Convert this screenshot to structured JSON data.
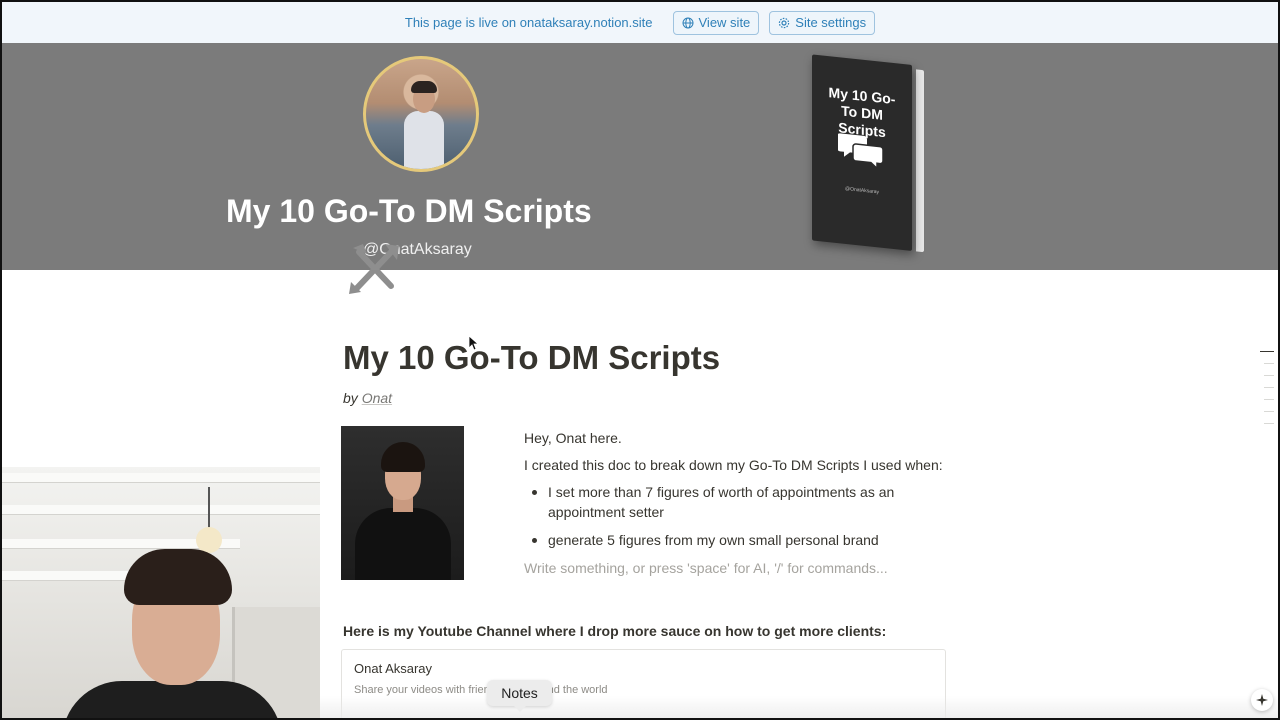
{
  "banner": {
    "live_text": "This page is live on onataksaray.notion.site",
    "view_site_label": "View site",
    "site_settings_label": "Site settings",
    "accent_color": "#2f80b8"
  },
  "cover": {
    "title": "My 10 Go-To DM Scripts",
    "handle": "@OnatAksaray",
    "book_title": "My 10 Go-To DM Scripts",
    "background_color": "#7b7b7b"
  },
  "page": {
    "title": "My 10 Go-To DM Scripts",
    "byline_prefix": "by",
    "author": "Onat",
    "intro": {
      "greeting": "Hey, Onat here.",
      "lead": "I created this doc to break down my Go-To DM Scripts I used when:",
      "bullets": [
        "I set more than 7 figures of worth of appointments as an appointment setter",
        "generate 5 figures from my own small personal brand"
      ],
      "placeholder": "Write something, or press 'space' for AI, '/' for commands..."
    },
    "youtube_heading": "Here is my Youtube Channel where I drop more sauce on how to get more clients:",
    "embed": {
      "title": "Onat Aksaray",
      "description": "Share your videos with friends, family, and the world"
    }
  },
  "tooltip": {
    "notes_label": "Notes"
  },
  "icons": {
    "view_site": "globe-icon",
    "site_settings": "gear-icon",
    "page_icon": "crossed-tools-icon",
    "ai_button": "sparkle-icon"
  }
}
